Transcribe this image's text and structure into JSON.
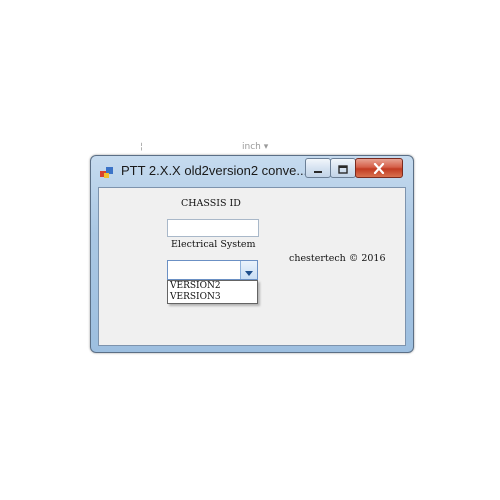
{
  "background": {
    "partial_tab_text": "¦",
    "partial_unit_text": "inch ▾"
  },
  "window": {
    "title": "PTT 2.X.X old2version2 conve...",
    "controls": {
      "minimize": "minimize",
      "maximize": "maximize",
      "close": "close"
    }
  },
  "form": {
    "chassis_label": "CHASSIS ID",
    "chassis_value": "",
    "electrical_label": "Electrical System",
    "combo_selected": "",
    "combo_options": [
      "VERSION2",
      "VERSION3"
    ],
    "copyright": "chestertech © 2016"
  },
  "colors": {
    "title_bar": "#a9c6e3",
    "client_bg": "#f0f0f0",
    "close_button": "#c13b22",
    "combo_arrow": "#1f4f8c"
  }
}
